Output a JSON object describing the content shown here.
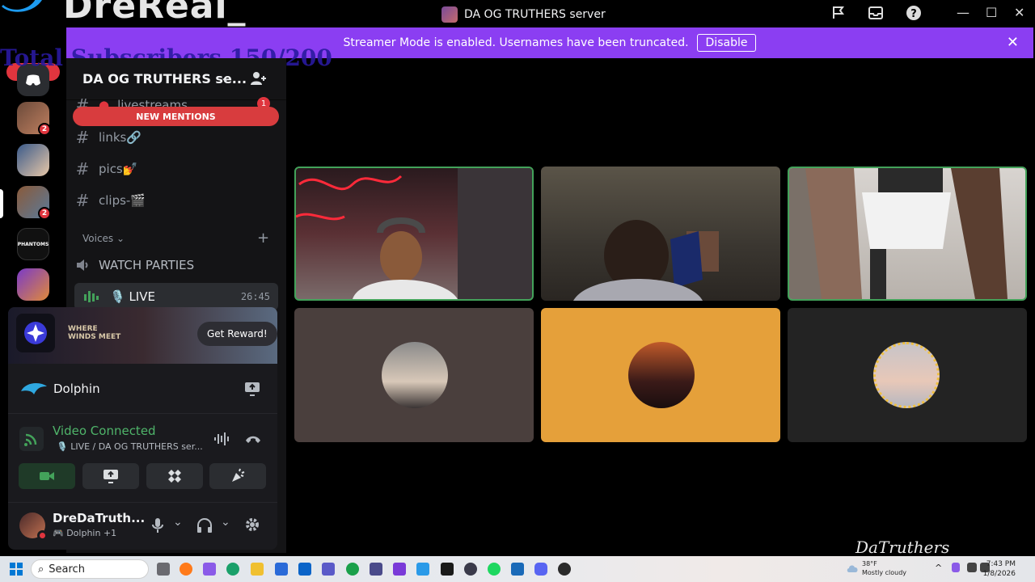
{
  "overlay": {
    "channel_name": "DreReal_",
    "subscribers": "Total Subscribers 150/200",
    "watermark": "DaTruthers"
  },
  "titlebar": {
    "title": "DA OG TRUTHERS server"
  },
  "banner": {
    "text": "Streamer Mode is enabled. Usernames have been truncated.",
    "button": "Disable"
  },
  "rail": {
    "new_label": "NEW",
    "servers": [
      {
        "badge": "2"
      },
      {
        "badge": ""
      },
      {
        "badge": "2"
      },
      {
        "badge": ""
      },
      {
        "badge": ""
      }
    ]
  },
  "sidebar": {
    "server_name": "DA OG TRUTHERS se...",
    "new_mentions": "NEW MENTIONS",
    "channels": [
      {
        "name": "livestreams",
        "badge": "1"
      },
      {
        "name": "links🔗"
      },
      {
        "name": "pics💅"
      },
      {
        "name": "clips-🎬"
      }
    ],
    "voice_category": "Voices",
    "watch_parties": "WATCH PARTIES",
    "live_channel": "🎙️ LIVE",
    "live_time": "26:45"
  },
  "panel": {
    "promo_logo_line1": "WHERE",
    "promo_logo_line2": "WINDS MEET",
    "reward_button": "Get Reward!",
    "activity_name": "Dolphin",
    "voice_status": "Video Connected",
    "voice_channel": "🎙️ LIVE / DA OG TRUTHERS ser...",
    "username": "DreDaTruth...",
    "user_activity": "Dolphin",
    "user_activity_extra": "+1"
  },
  "taskbar": {
    "search_placeholder": "Search",
    "weather_temp": "38°F",
    "weather_desc": "Mostly cloudy",
    "time": "7:43 PM",
    "date": "1/8/2026"
  },
  "colors": {
    "accent_purple": "#8b3ef2",
    "speaking_green": "#43a25a",
    "mention_red": "#d83c3e",
    "tile_brown": "#4a3f3d",
    "tile_orange": "#e5a03a",
    "tile_dark": "#232323"
  }
}
